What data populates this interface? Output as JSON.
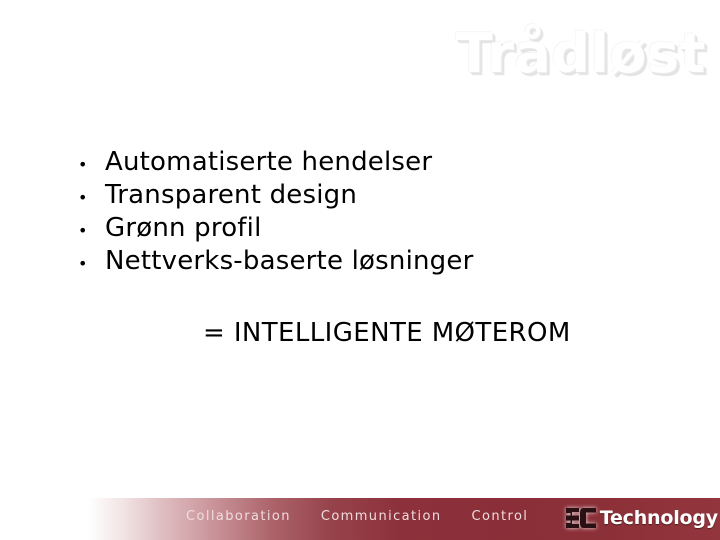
{
  "slide": {
    "title": "Trådløst",
    "bullets": [
      {
        "marker": "•",
        "label": "Automatiserte hendelser"
      },
      {
        "marker": "•",
        "label": "Transparent design"
      },
      {
        "marker": "•",
        "label": "Grønn profil"
      },
      {
        "marker": "•",
        "label": "Nettverks-baserte løsninger"
      }
    ],
    "conclusion": "=  INTELLIGENTE  MØTEROM"
  },
  "footer": {
    "words": [
      "Collaboration",
      "Communication",
      "Control"
    ],
    "logo": {
      "mark": "3C",
      "word": "Technology"
    }
  },
  "colors": {
    "background": "#ffffff",
    "title_text": "#ffffff",
    "title_shadow": "#e3e3e3",
    "body_text": "#000000",
    "footer_bar_dark": "#8a2e38",
    "footer_bar_light": "#ffffff",
    "footer_word_text": "#f0dcde",
    "logo_mark": "#2a1012",
    "logo_word": "#ffffff"
  }
}
